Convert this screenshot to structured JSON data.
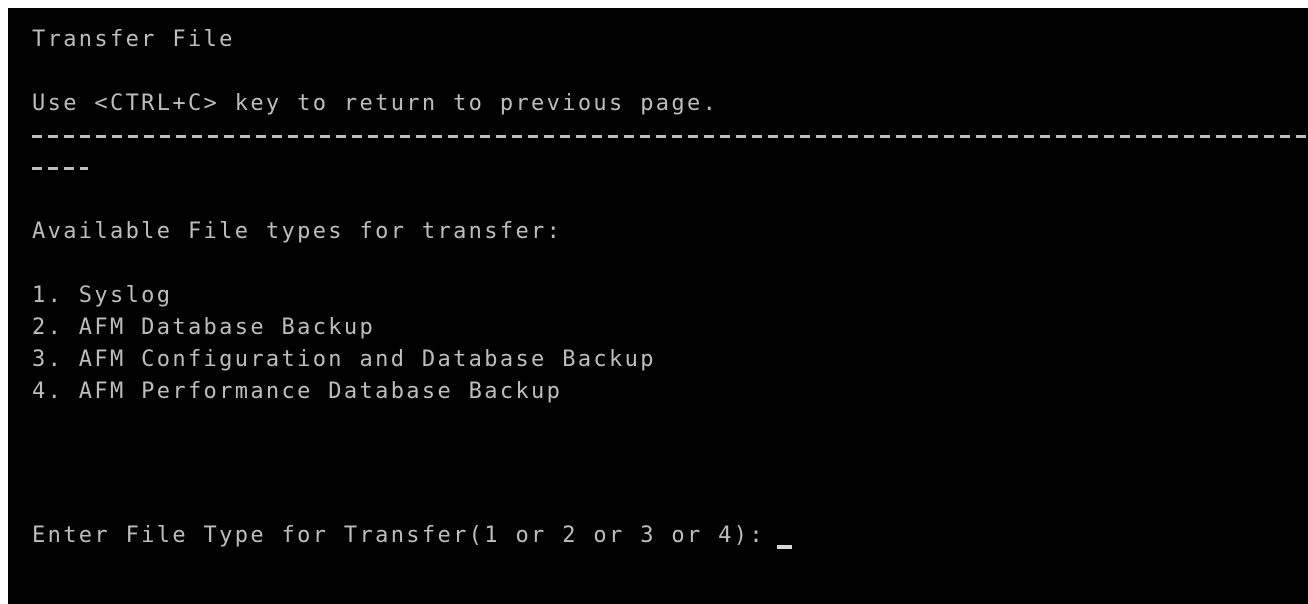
{
  "window": {
    "title": "Transfer File"
  },
  "instructions": {
    "return_hint": "Use <CTRL+C> key to return to previous page."
  },
  "section": {
    "heading": "Available File types for transfer:"
  },
  "file_types": [
    {
      "label": "1. Syslog"
    },
    {
      "label": "2. AFM Database Backup"
    },
    {
      "label": "3. AFM Configuration and Database Backup"
    },
    {
      "label": "4. AFM Performance Database Backup"
    }
  ],
  "prompt": {
    "label": "Enter File Type for Transfer(1 or 2 or 3 or 4):",
    "value": ""
  },
  "colors": {
    "background": "#000000",
    "text": "#bdbdbd",
    "cursor": "#d6d6d6"
  }
}
